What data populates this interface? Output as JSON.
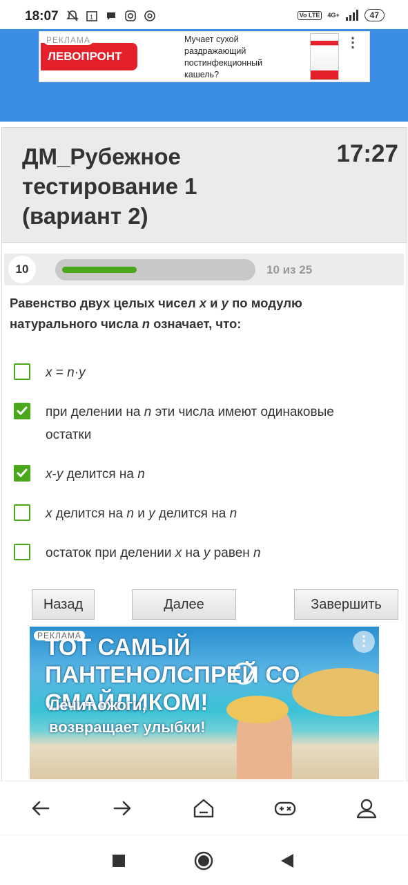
{
  "status_bar": {
    "time": "18:07",
    "network": "4G+",
    "volte": "Vo LTE",
    "battery": "47"
  },
  "ad_top": {
    "label": "РЕКЛАМА",
    "brand": "ЛЕВОПРОНТ",
    "text": "Мучает сухой раздражающий постинфекционный кашель?"
  },
  "quiz": {
    "title": "ДМ_Рубежное тестирование 1 (вариант 2)",
    "timer": "17:27",
    "question_number": "10",
    "progress_text": "10 из 25",
    "progress_fraction": 0.4,
    "question": "Равенство двух целых чисел x и y по модулю натурального числа n означает, что:",
    "options": [
      {
        "label": "x = n·y",
        "checked": false
      },
      {
        "label": "при делении на n эти числа имеют одинаковые остатки",
        "checked": true
      },
      {
        "label": "x-y делится на n",
        "checked": true
      },
      {
        "label": "x делится на n и y делится на n",
        "checked": false
      },
      {
        "label": "остаток при делении x на y равен n",
        "checked": false
      }
    ],
    "buttons": {
      "back": "Назад",
      "next": "Далее",
      "finish": "Завершить"
    }
  },
  "ad_bottom": {
    "label": "РЕКЛАМА",
    "headline": "ТОТ САМЫЙ ПАНТЕНОЛСПРЕЙ СО СМАЙЛИКОМ!",
    "subtext": "Лечит ожоги, возвращает улыбки!"
  },
  "colors": {
    "accent_green": "#4aa61a",
    "header_blue": "#3b8de5",
    "brand_red": "#e4202a"
  },
  "icons": {
    "bottom_nav": [
      "back-arrow-icon",
      "forward-arrow-icon",
      "home-icon",
      "gamepad-icon",
      "profile-icon"
    ],
    "system_nav": [
      "recents-icon",
      "home-circle-icon",
      "back-triangle-icon"
    ]
  }
}
